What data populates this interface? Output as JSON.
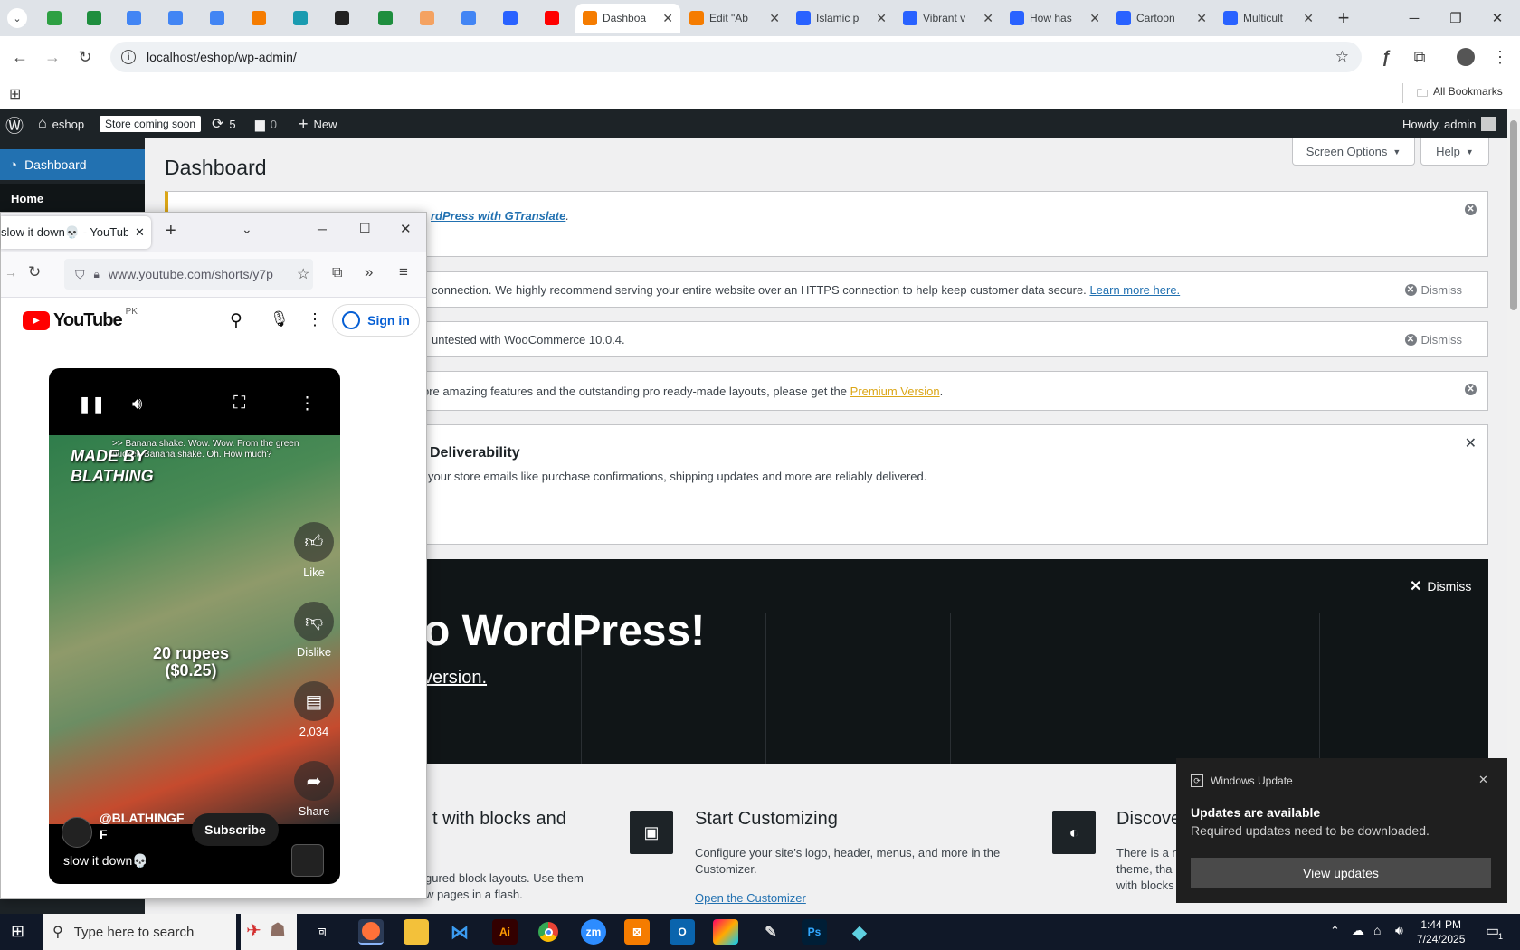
{
  "chrome": {
    "tabs": [
      {
        "title": "",
        "color": "#2ea043",
        "icon": "vpn-icon"
      },
      {
        "title": "",
        "color": "#1e8e3e",
        "icon": "sheets-icon"
      },
      {
        "title": "",
        "color": "#4285f4",
        "icon": "docs-icon"
      },
      {
        "title": "",
        "color": "#4285f4",
        "icon": "docs-icon"
      },
      {
        "title": "",
        "color": "#4285f4",
        "icon": "docs-icon"
      },
      {
        "title": "",
        "color": "#f57c00",
        "icon": "xampp-icon"
      },
      {
        "title": "",
        "color": "#1a9bb0",
        "icon": "app-icon"
      },
      {
        "title": "",
        "color": "#222222",
        "icon": "openai-icon"
      },
      {
        "title": "",
        "color": "#1e8e3e",
        "icon": "sheets-icon"
      },
      {
        "title": "",
        "color": "#f4a261",
        "icon": "hand-icon"
      },
      {
        "title": "",
        "color": "#4285f4",
        "icon": "grid-icon"
      },
      {
        "title": "",
        "color": "#2962ff",
        "icon": "forms-icon"
      },
      {
        "title": "",
        "color": "#ff0000",
        "icon": "youtube-icon"
      }
    ],
    "named_tabs": [
      {
        "title": "Dashboa",
        "color": "#f57c00",
        "icon": "xampp-icon",
        "active": true
      },
      {
        "title": "Edit \"Ab",
        "color": "#f57c00",
        "icon": "xampp-icon",
        "active": false
      },
      {
        "title": "Islamic p",
        "color": "#2962ff",
        "icon": "forms-icon",
        "active": false
      },
      {
        "title": "Vibrant v",
        "color": "#2962ff",
        "icon": "forms-icon",
        "active": false
      },
      {
        "title": "How has",
        "color": "#2962ff",
        "icon": "forms-icon",
        "active": false
      },
      {
        "title": "Cartoon",
        "color": "#2962ff",
        "icon": "forms-icon",
        "active": false
      },
      {
        "title": "Multicult",
        "color": "#2962ff",
        "icon": "forms-icon",
        "active": false
      }
    ],
    "url": "localhost/eshop/wp-admin/",
    "all_bookmarks": "All Bookmarks"
  },
  "adminbar": {
    "site": "eshop",
    "store_badge": "Store coming soon",
    "updates_count": "5",
    "comments_count": "0",
    "new_label": "New",
    "howdy": "Howdy, admin"
  },
  "sidebar": {
    "dashboard": "Dashboard",
    "home": "Home"
  },
  "wp": {
    "title": "Dashboard",
    "screen_options": "Screen Options",
    "help": "Help",
    "notice1_link": "rdPress with GTranslate",
    "notice1_tail": ".",
    "notice2_text": "connection. We highly recommend serving your entire website over an HTTPS connection to help keep customer data secure.",
    "notice2_link": "Learn more here.",
    "dismiss": "Dismiss",
    "notice3_text": "untested with WooCommerce 10.0.4.",
    "notice4_text": "ore amazing features and the outstanding pro ready-made layouts, please get the",
    "notice4_link": "Premium Version",
    "notice4_tail": ".",
    "notice5_title": "Deliverability",
    "notice5_text": "your store emails like purchase confirmations, shipping updates and more are reliably delivered.",
    "welcome_heading": "o WordPress!",
    "welcome_link": "version.",
    "welcome_dismiss": "Dismiss",
    "col1_title": "t with blocks and",
    "col1_text": "gured block layouts. Use them\nw pages in a flash.",
    "col2_title": "Start Customizing",
    "col2_text": "Configure your site’s logo, header, menus, and more in the Customizer.",
    "col2_link": "Open the Customizer",
    "col3_title": "Discove",
    "col3_text": "There is a n\ntheme, tha\nwith blocks"
  },
  "youtube": {
    "tab_title": "slow it down💀 - YouTube",
    "url": "www.youtube.com/shorts/y7p",
    "logo": "YouTube",
    "region": "PK",
    "signin": "Sign in",
    "caption": ">> Banana shake. Wow. Wow. From the green bucket. Banana shake. Oh. How much?",
    "overlay_text": "20 rupees\n($0.25)",
    "watermark": "MADE BY\nBLATHING",
    "like": "Like",
    "dislike": "Dislike",
    "comments": "2,034",
    "share": "Share",
    "channel": "@BLATHINGF\nF",
    "subscribe": "Subscribe",
    "video_title": "slow it down💀"
  },
  "toast": {
    "app": "Windows Update",
    "title": "Updates are available",
    "body": "Required updates need to be downloaded.",
    "button": "View updates"
  },
  "taskbar": {
    "search_placeholder": "Type here to search",
    "time": "1:44 PM",
    "date": "7/24/2025",
    "notification_count": "1",
    "apps": [
      {
        "label": "Ai",
        "color": "#330000",
        "fg": "#ff9a00"
      },
      {
        "label": "zm",
        "color": "#2d8cff",
        "fg": "#ffffff"
      },
      {
        "label": "Ps",
        "color": "#001e36",
        "fg": "#31a8ff"
      }
    ]
  }
}
